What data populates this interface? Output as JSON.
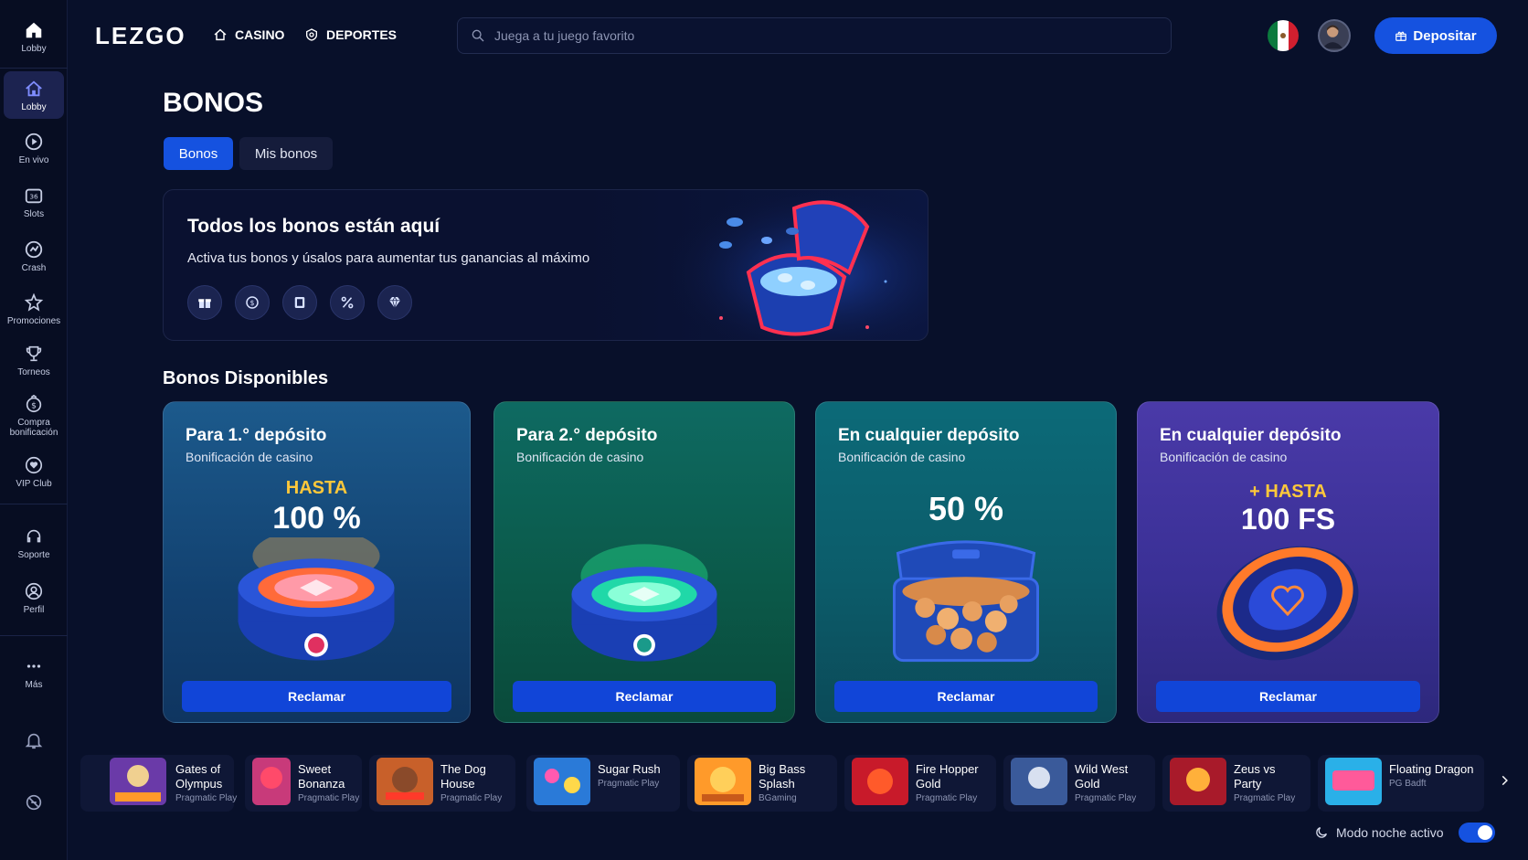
{
  "sidebar": {
    "items": [
      {
        "label": "Lobby"
      },
      {
        "label": "Lobby"
      },
      {
        "label": "En vivo"
      },
      {
        "label": "Slots"
      },
      {
        "label": "Crash"
      },
      {
        "label": "Promociones"
      },
      {
        "label": "Torneos"
      },
      {
        "label": "Compra bonificación"
      },
      {
        "label": "VIP Club"
      },
      {
        "label": "Soporte"
      },
      {
        "label": "Perfil"
      },
      {
        "label": "Más"
      }
    ]
  },
  "header": {
    "logo": "LEZGO",
    "nav": [
      {
        "label": "CASINO"
      },
      {
        "label": "DEPORTES"
      }
    ],
    "search_placeholder": "Juega a tu juego favorito",
    "deposit_label": "Depositar"
  },
  "page": {
    "title": "BONOS",
    "tabs": [
      {
        "label": "Bonos"
      },
      {
        "label": "Mis bonos"
      }
    ]
  },
  "hero": {
    "title": "Todos los bonos están aquí",
    "subtitle": "Activa tus bonos y úsalos para aumentar tus ganancias al máximo"
  },
  "bonuses": {
    "section_title": "Bonos Disponibles",
    "cards": [
      {
        "title": "Para 1.° depósito",
        "subtitle": "Bonificación de casino",
        "promo_top": "HASTA",
        "promo_value": "100 %",
        "button": "Reclamar"
      },
      {
        "title": "Para 2.° depósito",
        "subtitle": "Bonificación de casino",
        "promo_top": "",
        "promo_value": "",
        "button": "Reclamar"
      },
      {
        "title": "En cualquier depósito",
        "subtitle": "Bonificación de casino",
        "promo_top": "",
        "promo_value": "50 %",
        "button": "Reclamar"
      },
      {
        "title": "En cualquier depósito",
        "subtitle": "Bonificación de casino",
        "promo_top": "+ HASTA",
        "promo_value": "100 FS",
        "button": "Reclamar"
      }
    ]
  },
  "games": [
    {
      "name": "Gates of Olympus",
      "provider": "Pragmatic Play"
    },
    {
      "name": "Sweet Bonanza",
      "provider": "Pragmatic Play"
    },
    {
      "name": "The Dog House",
      "provider": "Pragmatic Play"
    },
    {
      "name": "Sugar Rush",
      "provider": "Pragmatic Play"
    },
    {
      "name": "Big Bass Splash",
      "provider": "BGaming"
    },
    {
      "name": "Fire Hopper Gold",
      "provider": "Pragmatic Play"
    },
    {
      "name": "Wild West Gold",
      "provider": "Pragmatic Play"
    },
    {
      "name": "Zeus vs Party",
      "provider": "Pragmatic Play"
    },
    {
      "name": "Floating Dragon",
      "provider": "PG Badft"
    }
  ],
  "night_mode": {
    "label": "Modo noche activo",
    "enabled": true
  },
  "colors": {
    "accent": "#1552e0",
    "background": "#08102a",
    "sidebar": "#070d22"
  }
}
